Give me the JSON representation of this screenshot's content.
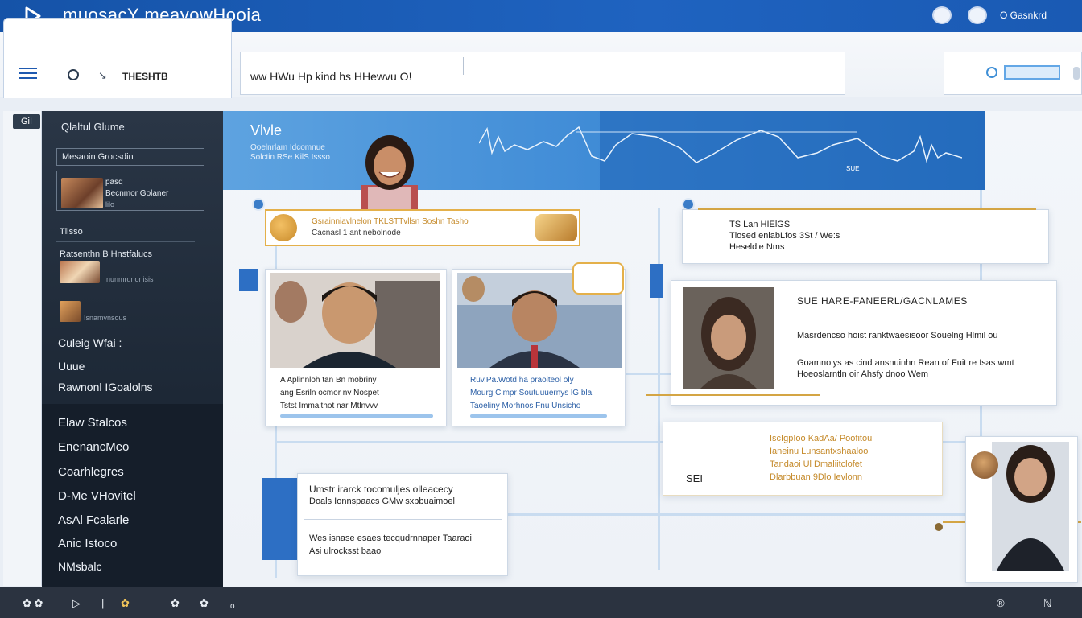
{
  "app": {
    "title": "muosacY meayowHooia",
    "account_label": "O Gasnkrd"
  },
  "toolbar": {
    "label": "THESHTB",
    "address": "ᴡᴡ HWu Hp kind hs HHewvu O!",
    "tag": "GiI"
  },
  "sidebar": {
    "header": "Qlaltul Glume",
    "subheader": "Mesaoin Grocsdin",
    "card": {
      "line1": "pasq",
      "line2": "Becnmor Golaner",
      "line3": "lilo"
    },
    "section": "Tlisso",
    "item2_title": "Ratsenthn B Hnstfalucs",
    "item2_meta": "nunmrdnonisis",
    "item3_meta": "Isnamvnsous",
    "nav": [
      "Culeig Wfai :",
      "Uuue",
      "Rawnonl IGoalolns",
      "Elaw Stalcos",
      "EnenancMeo",
      "Coarhlegres",
      "D-Me VHovitel",
      "AsAl Fcalarle",
      "Anic Istoco",
      "NMsbalc"
    ]
  },
  "hero": {
    "title": "Vlvle",
    "sub1": "Ooelnrlam Idcomnue",
    "sub2": "Solctin RSe KilS Issso",
    "chart_label": "SUE"
  },
  "note_top": {
    "line1": "Gsrainniavlnelon TKLSTTvllsn Soshn Tasho",
    "line2": "Cacnasl 1 ant nebolnode"
  },
  "note_right": {
    "line1": "TS Lan HIElGS",
    "line2": "Tlosed enlabLfos 3St / We:s",
    "line3": "Heseldle Nms"
  },
  "card_left": {
    "line1": "A Aplinnloh tan Bn mobriny",
    "line2": "ang Esriln ocmor nv Nospet",
    "line3": "Tstst Immaitnot nar Mtlnvvv"
  },
  "card_mid": {
    "line1": "Ruv.Pa.Wotd ha praoiteol oly",
    "line2": "Mourg Cimpr Soutuuuernys lG bla",
    "line3": "Taoeliny Morhnos Fnu Unsicho"
  },
  "profile_panel": {
    "heading": "SUE HARE-FANEERL/GACNLAMES",
    "line1": "Masrdencso hoist ranktwaesisoor Souelng Hlmil ou",
    "line2": "Goamnolys as cind ansnuinhn Rean of Fuit re Isas wmt",
    "line3": "Hoeoslarntln oir Ahsfy dnoo Wem"
  },
  "lower_note": {
    "line1": "IscIgpIoo KadAa/ Poofitou",
    "line2": "Ianeinu Lunsantxshaaloo",
    "line3": "Tandaoi Ul Dmaliitclofet",
    "line4": "Dlarbbuan 9Dlo Ievlonn",
    "tag": "SEI"
  },
  "bottom_panel": {
    "line1": "Umstr irarck tocomuljes olleacecy",
    "line2": "Doals Ionnspaacs GMw sxbbuaimoel",
    "line3": "Wes isnase esaes tecqudrnnaper Taaraoi",
    "line4": "Asi ulrocksst baao"
  },
  "status": {
    "items": [
      "✿ ✿",
      "▷",
      "|",
      "✿",
      "✿",
      "✿",
      "o"
    ],
    "right1": "®",
    "right2": "ℕ"
  },
  "colors": {
    "brand": "#1f63c0",
    "sidebar": "#1d2836",
    "accent_gold": "#d4a544",
    "hero_blue": "#3f8bd6"
  }
}
